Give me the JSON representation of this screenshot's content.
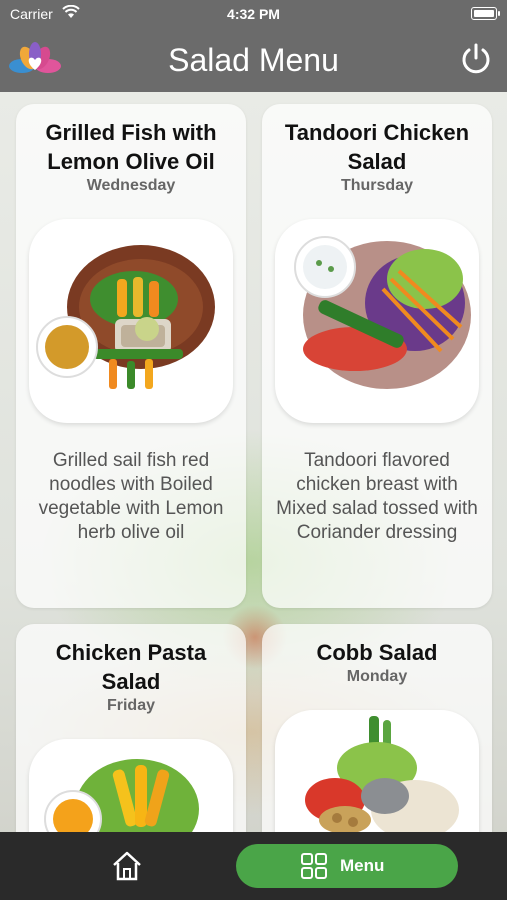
{
  "status_bar": {
    "carrier": "Carrier",
    "time": "4:32 PM"
  },
  "header": {
    "title": "Salad Menu",
    "logo_icon": "lotus-heart-logo",
    "power_icon": "power-icon"
  },
  "cards": [
    {
      "title": "Grilled Fish with Lemon Olive Oil",
      "day": "Wednesday",
      "description": "Grilled sail fish red noodles with Boiled vegetable with Lemon herb olive oil"
    },
    {
      "title": "Tandoori Chicken Salad",
      "day": "Thursday",
      "description": "Tandoori flavored chicken breast with Mixed salad tossed with Coriander dressing"
    },
    {
      "title": "Chicken Pasta Salad",
      "day": "Friday",
      "description": ""
    },
    {
      "title": "Cobb Salad",
      "day": "Monday",
      "description": ""
    }
  ],
  "tab_bar": {
    "home_icon": "home-icon",
    "menu_label": "Menu",
    "menu_icon": "grid-icon",
    "accent": "#4aa548"
  }
}
